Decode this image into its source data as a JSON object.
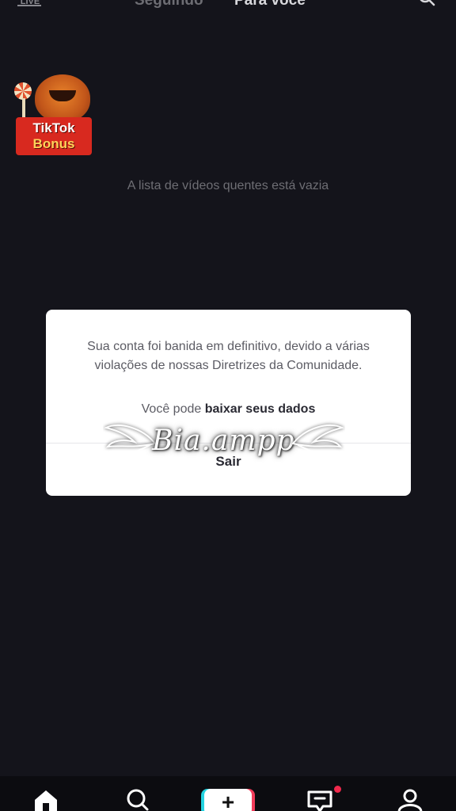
{
  "top_bar": {
    "live_label": "LIVE",
    "tabs": [
      {
        "label": "Seguindo",
        "active": false
      },
      {
        "label": "Para você",
        "active": true
      }
    ],
    "search_icon": "search-icon"
  },
  "bonus_badge": {
    "line1": "TikTok",
    "line2": "Bonus"
  },
  "feed": {
    "empty_message": "A lista de vídeos quentes está vazia"
  },
  "dialog": {
    "message": "Sua conta foi banida em definitivo, devido a várias violações de nossas Diretrizes da Comunidade.",
    "download_prefix": "Você pode",
    "download_link": "baixar seus dados",
    "button_label": "Sair"
  },
  "watermark": {
    "text": "Bia.ampp"
  },
  "bottom_nav": {
    "items": [
      {
        "icon": "home-icon"
      },
      {
        "icon": "search-icon"
      },
      {
        "icon": "plus-icon",
        "label": "+"
      },
      {
        "icon": "inbox-icon",
        "has_notification": true
      },
      {
        "icon": "profile-icon"
      }
    ]
  },
  "colors": {
    "background": "#14141b",
    "dialog_bg": "#ffffff",
    "notification": "#f0294c",
    "accent_cyan": "#24d3e0",
    "accent_red": "#f23c5a"
  }
}
